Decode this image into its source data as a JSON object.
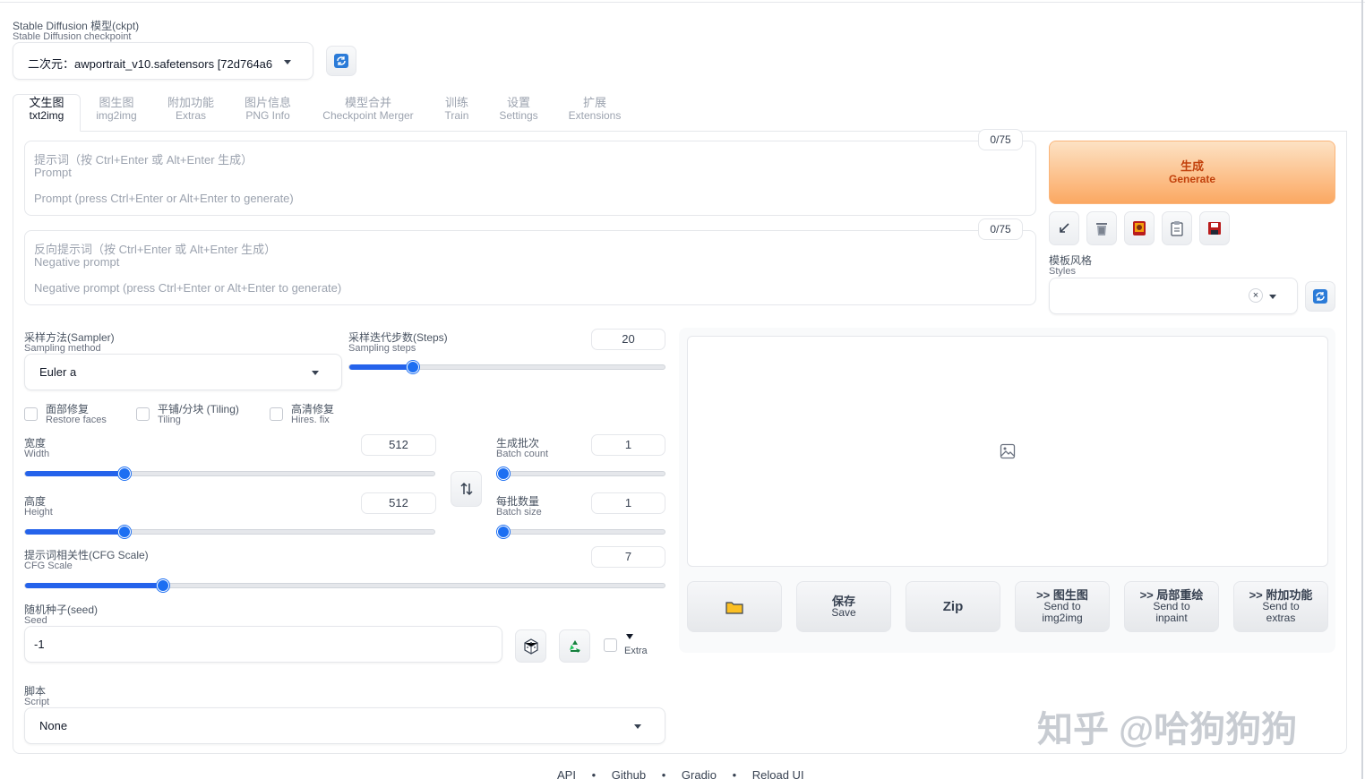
{
  "checkpoint": {
    "label_zh": "Stable Diffusion 模型(ckpt)",
    "label_en": "Stable Diffusion checkpoint",
    "value": "二次元：awportrait_v10.safetensors [72d764a6"
  },
  "tabs": [
    {
      "zh": "文生图",
      "en": "txt2img"
    },
    {
      "zh": "图生图",
      "en": "img2img"
    },
    {
      "zh": "附加功能",
      "en": "Extras"
    },
    {
      "zh": "图片信息",
      "en": "PNG Info"
    },
    {
      "zh": "模型合并",
      "en": "Checkpoint Merger"
    },
    {
      "zh": "训练",
      "en": "Train"
    },
    {
      "zh": "设置",
      "en": "Settings"
    },
    {
      "zh": "扩展",
      "en": "Extensions"
    }
  ],
  "prompt": {
    "counter": "0/75",
    "label_zh": "提示词（按 Ctrl+Enter 或 Alt+Enter 生成）",
    "label_en": "Prompt",
    "placeholder": "Prompt (press Ctrl+Enter or Alt+Enter to generate)"
  },
  "negative": {
    "counter": "0/75",
    "label_zh": "反向提示词（按 Ctrl+Enter 或 Alt+Enter 生成）",
    "label_en": "Negative prompt",
    "placeholder": "Negative prompt (press Ctrl+Enter or Alt+Enter to generate)"
  },
  "generate": {
    "zh": "生成",
    "en": "Generate"
  },
  "styles": {
    "label_zh": "模板风格",
    "label_en": "Styles"
  },
  "sampler": {
    "label_zh": "采样方法(Sampler)",
    "label_en": "Sampling method",
    "value": "Euler a"
  },
  "steps": {
    "label_zh": "采样迭代步数(Steps)",
    "label_en": "Sampling steps",
    "value": "20",
    "fraction": 0.19
  },
  "checks": {
    "restore": {
      "zh": "面部修复",
      "en": "Restore faces"
    },
    "tiling": {
      "zh": "平铺/分块 (Tiling)",
      "en": "Tiling"
    },
    "hires": {
      "zh": "高清修复",
      "en": "Hires. fix"
    }
  },
  "width": {
    "label_zh": "宽度",
    "label_en": "Width",
    "value": "512",
    "fraction": 0.235
  },
  "height": {
    "label_zh": "高度",
    "label_en": "Height",
    "value": "512",
    "fraction": 0.235
  },
  "batch_count": {
    "label_zh": "生成批次",
    "label_en": "Batch count",
    "value": "1",
    "fraction": 0.0
  },
  "batch_size": {
    "label_zh": "每批数量",
    "label_en": "Batch size",
    "value": "1",
    "fraction": 0.0
  },
  "cfg": {
    "label_zh": "提示词相关性(CFG Scale)",
    "label_en": "CFG Scale",
    "value": "7",
    "fraction": 0.21
  },
  "seed": {
    "label_zh": "随机种子(seed)",
    "label_en": "Seed",
    "value": "-1",
    "extra": "Extra"
  },
  "script": {
    "label_zh": "脚本",
    "label_en": "Script",
    "value": "None"
  },
  "actions": {
    "save": {
      "zh": "保存",
      "en": "Save"
    },
    "zip": "Zip",
    "img2img": {
      "zh": ">> 图生图",
      "en1": "Send to",
      "en2": "img2img"
    },
    "inpaint": {
      "zh": ">> 局部重绘",
      "en1": "Send to",
      "en2": "inpaint"
    },
    "extras": {
      "zh": ">> 附加功能",
      "en1": "Send to",
      "en2": "extras"
    }
  },
  "footer": [
    "API",
    "Github",
    "Gradio",
    "Reload UI"
  ],
  "watermark": "知乎 @哈狗狗狗",
  "colors": {
    "accent": "#2563eb",
    "generate_top": "#fdd3a9",
    "generate_bottom": "#fba45b",
    "generate_text": "#c2410c"
  }
}
